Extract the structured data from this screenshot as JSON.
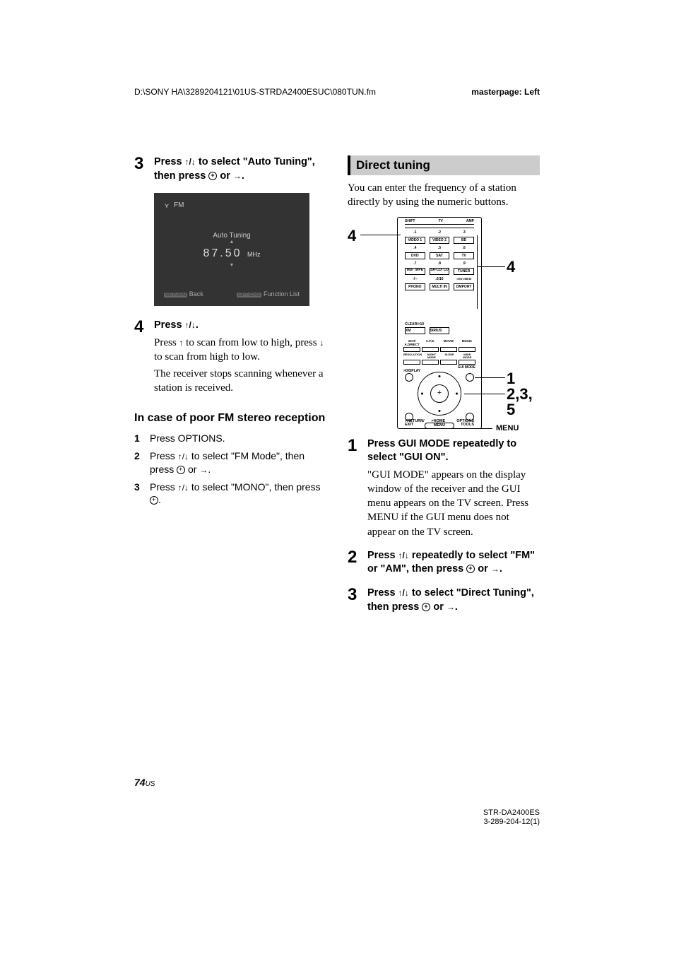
{
  "header": {
    "path": "D:\\SONY HA\\3289204121\\01US-STRDA2400ESUC\\080TUN.fm",
    "master": "masterpage: Left"
  },
  "left": {
    "step3": {
      "num": "3",
      "title_a": "Press ",
      "title_b": " to select \"Auto Tuning\", then press ",
      "title_c": " or ",
      "title_d": "."
    },
    "tv": {
      "band": "FM",
      "mode_label": "Auto Tuning",
      "freq": "87.50",
      "unit": "MHz",
      "back_label": "Back",
      "fn_label": "Function List",
      "return_btn": "RETURN",
      "options_btn": "OPTIONS"
    },
    "step4": {
      "num": "4",
      "title_a": "Press ",
      "title_b": ".",
      "para1a": "Press ",
      "para1b": " to scan from low to high, press ",
      "para1c": " to scan from high to low.",
      "para2": "The receiver stops scanning whenever a station is received."
    },
    "subhead": "In case of poor FM stereo reception",
    "s1": {
      "n": "1",
      "t": "Press OPTIONS."
    },
    "s2": {
      "n": "2",
      "t_a": "Press ",
      "t_b": " to select \"FM Mode\", then press ",
      "t_c": " or ",
      "t_d": "."
    },
    "s3": {
      "n": "3",
      "t_a": "Press ",
      "t_b": " to select \"MONO\", then press ",
      "t_c": "."
    }
  },
  "right": {
    "section": "Direct tuning",
    "intro": "You can enter the frequency of a station directly by using the numeric buttons.",
    "remote": {
      "top_row": [
        "SHIFT",
        "TV",
        "AMP"
      ],
      "n1": [
        ".1",
        ".2",
        ".3"
      ],
      "r1": [
        "VIDEO 1",
        "VIDEO 2",
        "BD"
      ],
      "n2": [
        ".4",
        ".5",
        ".6"
      ],
      "r2": [
        "DVD",
        "SAT",
        "TV"
      ],
      "n3": [
        ".7",
        ".8",
        ".9"
      ],
      "r3": [
        "MD/\nTAPE",
        "SA-CD/\nCD",
        "TUNER"
      ],
      "n4": [
        "-/--",
        ".0/10",
        ">ENT/MEM"
      ],
      "r4": [
        "PHONO",
        "MULTI IN",
        "DMPORT"
      ],
      "clear": "CLEAR/>10",
      "r5": [
        "XM",
        "SIRIUS"
      ],
      "mod_lbl": [
        " 2CH/\nA.DIRECT",
        "A.F.D.",
        "MOVIE",
        "MUSIC"
      ],
      "mod2_lbl": [
        "RESOLUTION",
        "NIGHT\nMODE",
        "SLEEP",
        "WIDE\nMODE"
      ],
      "disp": ">DISPLAY",
      "gui": "GUI\nMODE",
      "return": ">RETURN/\nEXIT",
      "home": ">HOME",
      "options": "OPTIONS\nTOOLS",
      "menu": "MENU"
    },
    "pointers": {
      "p4a": "4",
      "p4b": "4",
      "p1": "1",
      "p235": "2,3,\n5",
      "menu_label": "MENU"
    },
    "step1": {
      "num": "1",
      "title": "Press GUI MODE repeatedly to select \"GUI ON\".",
      "para": "\"GUI MODE\" appears on the display window of the receiver and the GUI menu appears on the TV screen.  Press MENU if the GUI menu does not appear on the TV screen."
    },
    "step2": {
      "num": "2",
      "title_a": "Press ",
      "title_b": " repeatedly to select \"FM\" or \"AM\", then press ",
      "title_c": " or ",
      "title_d": "."
    },
    "step3": {
      "num": "3",
      "title_a": "Press ",
      "title_b": " to select \"Direct Tuning\", then press ",
      "title_c": " or ",
      "title_d": "."
    }
  },
  "footer": {
    "pagenum": "74",
    "pagesub": "US",
    "model": "STR-DA2400ES",
    "partno": "3-289-204-12(1)"
  },
  "glyphs": {
    "updown": "↑/↓",
    "up": "↑",
    "down": "↓",
    "right": "→"
  }
}
